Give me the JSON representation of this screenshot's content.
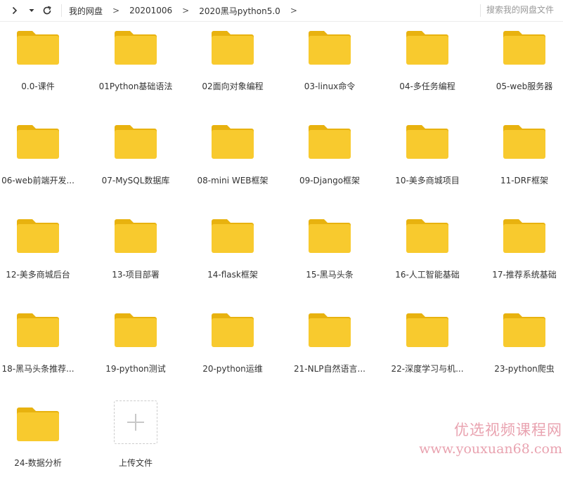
{
  "toolbar": {
    "breadcrumb": [
      "我的网盘",
      "20201006",
      "2020黑马python5.0"
    ],
    "search_placeholder": "搜索我的网盘文件"
  },
  "colors": {
    "folder_body": "#f8ca2e",
    "folder_tab": "#e8b20f",
    "text": "#333333",
    "watermark": "#e9a3b0"
  },
  "folders": [
    {
      "label": "0.0-课件"
    },
    {
      "label": "01Python基础语法"
    },
    {
      "label": "02面向对象编程"
    },
    {
      "label": "03-linux命令"
    },
    {
      "label": "04-多任务编程"
    },
    {
      "label": "05-web服务器"
    },
    {
      "label": "06-web前端开发..."
    },
    {
      "label": "07-MySQL数据库"
    },
    {
      "label": "08-mini WEB框架"
    },
    {
      "label": "09-Django框架"
    },
    {
      "label": "10-美多商城项目"
    },
    {
      "label": "11-DRF框架"
    },
    {
      "label": "12-美多商城后台"
    },
    {
      "label": "13-项目部署"
    },
    {
      "label": "14-flask框架"
    },
    {
      "label": "15-黑马头条"
    },
    {
      "label": "16-人工智能基础"
    },
    {
      "label": "17-推荐系统基础"
    },
    {
      "label": "18-黑马头条推荐..."
    },
    {
      "label": "19-python测试"
    },
    {
      "label": "20-python运维"
    },
    {
      "label": "21-NLP自然语言..."
    },
    {
      "label": "22-深度学习与机..."
    },
    {
      "label": "23-python爬虫"
    },
    {
      "label": "24-数据分析"
    }
  ],
  "upload": {
    "label": "上传文件",
    "icon": "plus-icon"
  },
  "watermark": {
    "line1": "优选视频课程网",
    "line2": "www.youxuan68.com"
  }
}
